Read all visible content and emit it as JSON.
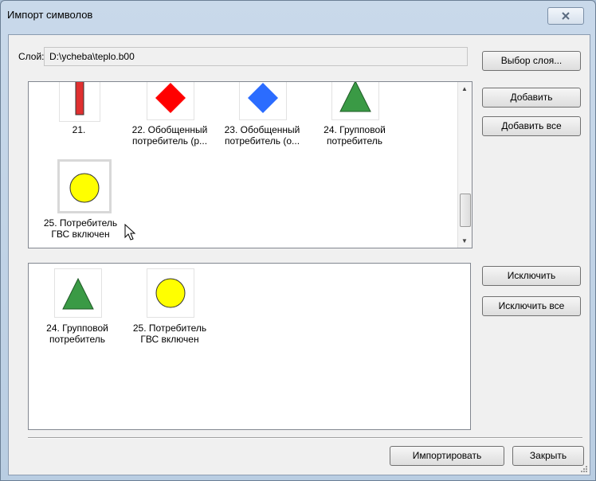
{
  "window": {
    "title": "Импорт символов"
  },
  "layer": {
    "label": "Слой:",
    "path": "D:\\ycheba\\teplo.b00",
    "select_button": "Выбор слоя..."
  },
  "available": {
    "items": [
      {
        "label_line1": "21.",
        "label_line2": "",
        "icon": "red-bar-icon",
        "color": "#e03030"
      },
      {
        "label_line1": "22. Обобщенный",
        "label_line2": "потребитель (р...",
        "icon": "red-diamond-icon",
        "color": "#ff0000"
      },
      {
        "label_line1": "23. Обобщенный",
        "label_line2": "потребитель (о...",
        "icon": "blue-diamond-icon",
        "color": "#2b6cff"
      },
      {
        "label_line1": "24. Групповой",
        "label_line2": "потребитель",
        "icon": "green-triangle-icon",
        "color": "#3a9a45"
      },
      {
        "label_line1": "25. Потребитель",
        "label_line2": "ГВС включен",
        "icon": "yellow-circle-icon",
        "color": "#ffff00"
      }
    ],
    "add_button": "Добавить",
    "add_all_button": "Добавить все"
  },
  "selected": {
    "items": [
      {
        "label_line1": "24. Групповой",
        "label_line2": "потребитель",
        "icon": "green-triangle-icon",
        "color": "#3a9a45"
      },
      {
        "label_line1": "25. Потребитель",
        "label_line2": "ГВС включен",
        "icon": "yellow-circle-icon",
        "color": "#ffff00"
      }
    ],
    "exclude_button": "Исключить",
    "exclude_all_button": "Исключить все"
  },
  "footer": {
    "import_button": "Импортировать",
    "close_button": "Закрыть"
  }
}
